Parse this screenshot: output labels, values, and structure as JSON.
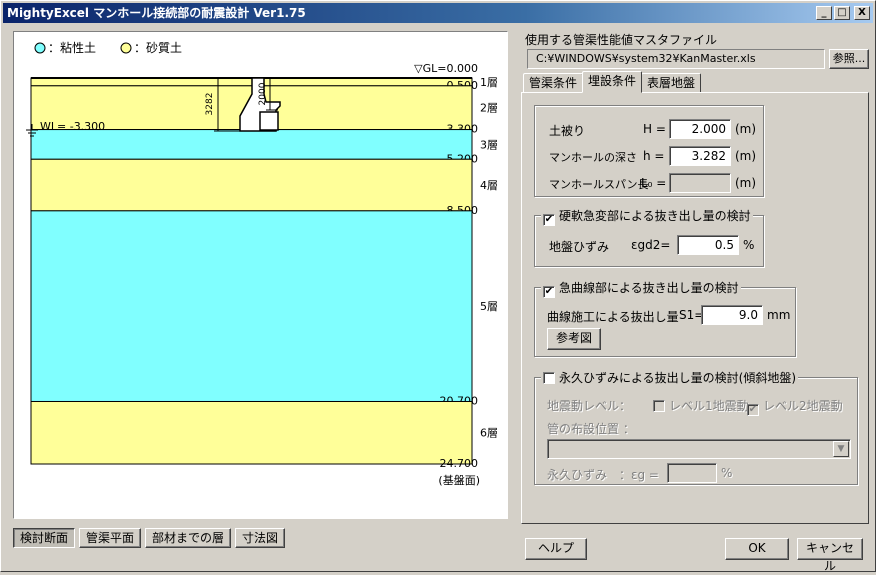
{
  "window": {
    "title": "MightyExcel マンホール接続部の耐震設計 Ver1.75"
  },
  "titlebar_buttons": {
    "minimize": "_",
    "maximize": "□",
    "close": "X"
  },
  "legend": {
    "clay": "：粘性土",
    "sand": "：砂質土"
  },
  "colors": {
    "clay": "#80ffff",
    "sand": "#ffff99",
    "titlebar": "#0a246a"
  },
  "drawing": {
    "gl_label": "▽GL=0.000",
    "wl_label": "WL= -3.300",
    "manhole_depth_label": "3282",
    "cover_label": "2000",
    "base_label": "(基盤面)",
    "layer_depths": [
      "-0.500",
      "-3.300",
      "-5.200",
      "-8.500",
      "-20.700",
      "-24.700"
    ],
    "layers": [
      {
        "name": "1層",
        "top": 0.0,
        "bottom": 0.5,
        "soil": "sand"
      },
      {
        "name": "2層",
        "top": 0.5,
        "bottom": 3.3,
        "soil": "sand"
      },
      {
        "name": "3層",
        "top": 3.3,
        "bottom": 5.2,
        "soil": "clay"
      },
      {
        "name": "4層",
        "top": 5.2,
        "bottom": 8.5,
        "soil": "sand"
      },
      {
        "name": "5層",
        "top": 8.5,
        "bottom": 20.7,
        "soil": "clay"
      },
      {
        "name": "6層",
        "top": 20.7,
        "bottom": 24.7,
        "soil": "sand"
      }
    ]
  },
  "view_buttons": [
    "検討断面",
    "管渠平面",
    "部材までの層",
    "寸法図"
  ],
  "master": {
    "label": "使用する管渠性能値マスタファイル",
    "path": "C:¥WINDOWS¥system32¥KanMaster.xls",
    "browse": "参照..."
  },
  "tabs": [
    "管渠条件",
    "埋設条件",
    "表層地盤"
  ],
  "burial": {
    "cover": {
      "label": "土被り",
      "symbol": "H =",
      "value": "2.000",
      "unit": "(m)"
    },
    "depth": {
      "label": "マンホールの深さ",
      "symbol": "h =",
      "value": "3.282",
      "unit": "(m)"
    },
    "span": {
      "label": "マンホールスパン長",
      "symbol": "L₀ =",
      "value": "",
      "unit": "(m)"
    }
  },
  "group1": {
    "title": "硬軟急変部による抜き出し量の検討",
    "checked": "✔",
    "label": "地盤ひずみ",
    "symbol": "εgd2=",
    "value": "0.5",
    "unit": "%"
  },
  "group2": {
    "title": "急曲線部による抜き出し量の検討",
    "checked": "✔",
    "label": "曲線施工による抜出し量",
    "symbol": "S1=",
    "value": "9.0",
    "unit": "mm",
    "ref_button": "参考図"
  },
  "group3": {
    "title": "永久ひずみによる抜出し量の検討(傾斜地盤)",
    "checked": "",
    "quake_label": "地震動レベル：",
    "level1": "レベル1地震動",
    "level1_checked": "",
    "level2": "レベル2地震動",
    "level2_checked": "✔",
    "position_label": "管の布設位置 ：",
    "position_value": "",
    "strain_label": "永久ひずみ",
    "strain_symbol": "：εg =",
    "strain_value": "",
    "strain_unit": "%"
  },
  "footer": {
    "help": "ヘルプ",
    "ok": "OK",
    "cancel": "キャンセル"
  }
}
